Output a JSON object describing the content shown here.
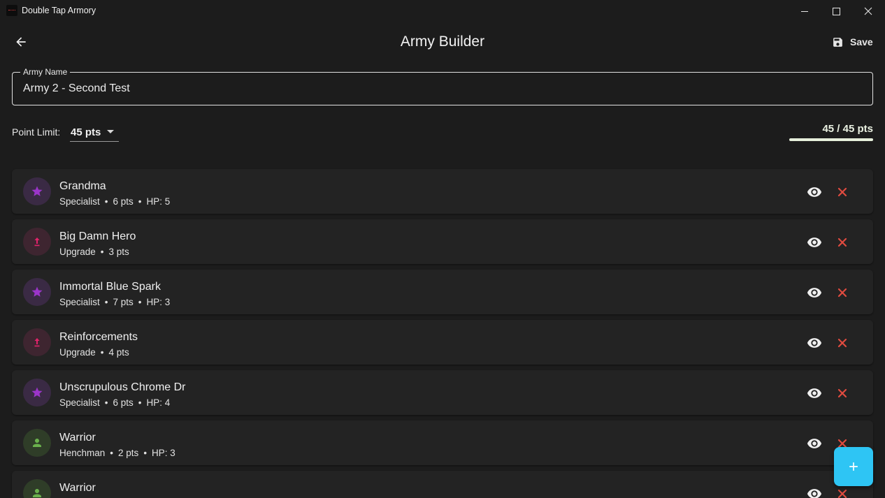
{
  "window": {
    "title": "Double Tap Armory"
  },
  "header": {
    "title": "Army Builder",
    "save_label": "Save"
  },
  "army_name": {
    "label": "Army Name",
    "value": "Army 2 - Second Test"
  },
  "point_limit": {
    "label": "Point Limit:",
    "selected": "45 pts",
    "summary": "45 / 45 pts",
    "used": 45,
    "limit": 45
  },
  "colors": {
    "specialist_icon": "#9b35c9",
    "upgrade_icon": "#e3236b",
    "henchman_icon": "#6ab04c",
    "delete": "#e04b3f",
    "fab": "#2ec5f4"
  },
  "units": [
    {
      "name": "Grandma",
      "type": "Specialist",
      "points": "6 pts",
      "hp": "HP: 5",
      "icon": "star-icon"
    },
    {
      "name": "Big Damn Hero",
      "type": "Upgrade",
      "points": "3 pts",
      "hp": "",
      "icon": "upgrade-arrow-icon"
    },
    {
      "name": "Immortal Blue Spark",
      "type": "Specialist",
      "points": "7 pts",
      "hp": "HP: 3",
      "icon": "star-icon"
    },
    {
      "name": "Reinforcements",
      "type": "Upgrade",
      "points": "4 pts",
      "hp": "",
      "icon": "upgrade-arrow-icon"
    },
    {
      "name": "Unscrupulous Chrome Dr",
      "type": "Specialist",
      "points": "6 pts",
      "hp": "HP: 4",
      "icon": "star-icon"
    },
    {
      "name": "Warrior",
      "type": "Henchman",
      "points": "2 pts",
      "hp": "HP: 3",
      "icon": "person-icon"
    },
    {
      "name": "Warrior",
      "type": "",
      "points": "",
      "hp": "",
      "icon": "person-icon"
    }
  ],
  "fab": {
    "icon": "plus-icon"
  }
}
